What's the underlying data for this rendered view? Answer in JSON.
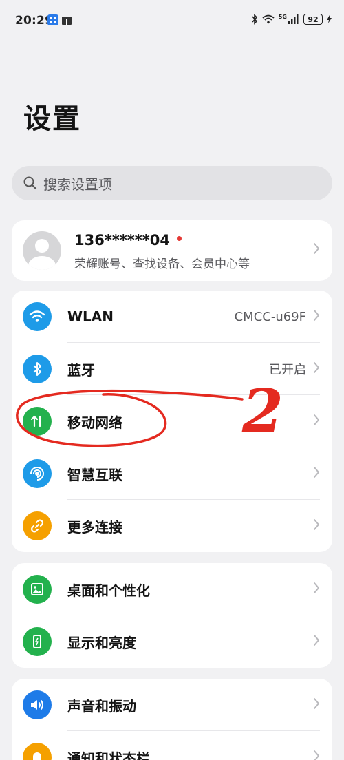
{
  "status": {
    "time": "20:29",
    "battery": "92",
    "signal_label": "5G"
  },
  "title": "设置",
  "search": {
    "placeholder": "搜索设置项"
  },
  "account": {
    "name": "136******04",
    "subtitle": "荣耀账号、查找设备、会员中心等"
  },
  "network": {
    "wlan_label": "WLAN",
    "wlan_value": "CMCC-u69F",
    "bluetooth_label": "蓝牙",
    "bluetooth_value": "已开启",
    "mobile_label": "移动网络",
    "smart_label": "智慧互联",
    "more_label": "更多连接"
  },
  "display": {
    "desktop_label": "桌面和个性化",
    "brightness_label": "显示和亮度"
  },
  "sound": {
    "sound_label": "声音和振动",
    "notify_label": "通知和状态栏"
  },
  "annotation": {
    "number": "2"
  },
  "colors": {
    "wifi": "#1e9be8",
    "bluetooth": "#1e9be8",
    "mobile": "#23b14d",
    "smart": "#1e9be8",
    "more": "#f5a000",
    "desktop": "#23b14d",
    "brightness": "#23b14d",
    "sound": "#1e7be8",
    "notify": "#f5a000",
    "annotation": "#e42a20"
  }
}
